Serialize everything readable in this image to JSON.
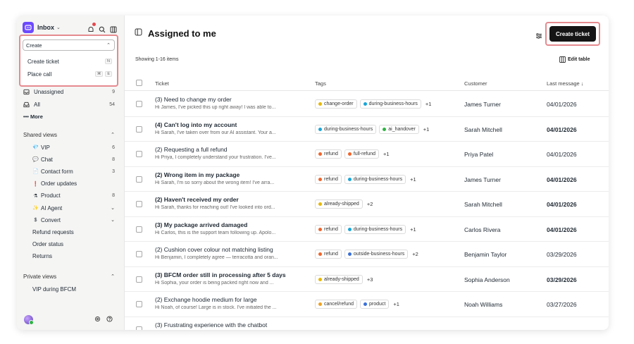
{
  "sidebar": {
    "inbox_label": "Inbox",
    "create_menu": {
      "select_label": "Create",
      "items": [
        {
          "label": "Create ticket",
          "shortcut": [
            "N"
          ]
        },
        {
          "label": "Place call",
          "shortcut": [
            "⌘",
            "E"
          ]
        }
      ]
    },
    "views": [
      {
        "label": "Unassigned",
        "count": "9",
        "icon": "inbox-icon"
      },
      {
        "label": "All",
        "count": "54",
        "icon": "tray-icon"
      }
    ],
    "more_label": "••• More",
    "shared_views": {
      "title": "Shared views",
      "items": [
        {
          "emoji": "💎",
          "label": "VIP",
          "count": "6"
        },
        {
          "emoji": "💬",
          "label": "Chat",
          "count": "8"
        },
        {
          "emoji": "📄",
          "label": "Contact form",
          "count": "3"
        },
        {
          "emoji": "❗",
          "label": "Order updates",
          "count": ""
        },
        {
          "emoji": "⚗",
          "label": "Product",
          "count": "8"
        },
        {
          "emoji": "✨",
          "label": "AI Agent",
          "count": "",
          "expandable": true
        },
        {
          "emoji": "$",
          "label": "Convert",
          "count": "",
          "expandable": true
        },
        {
          "emoji": "",
          "label": "Refund requests",
          "count": ""
        },
        {
          "emoji": "",
          "label": "Order status",
          "count": ""
        },
        {
          "emoji": "",
          "label": "Returns",
          "count": ""
        }
      ]
    },
    "private_views": {
      "title": "Private views",
      "items": [
        {
          "label": "VIP during BFCM"
        }
      ]
    }
  },
  "main": {
    "title": "Assigned to me",
    "create_button": "Create ticket",
    "showing": "Showing 1-16 items",
    "edit_table": "Edit table",
    "columns": {
      "ticket": "Ticket",
      "tags": "Tags",
      "customer": "Customer",
      "last_message": "Last message ↓"
    }
  },
  "tag_colors": {
    "change-order": "#e8b700",
    "during-business-hours": "#1aa5d6",
    "ai_handover": "#2fb344",
    "refund": "#f0642b",
    "full-refund": "#f0642b",
    "already-shipped": "#e8b700",
    "outside-business-hours": "#3b6fd6",
    "cancel/refund": "#f0a020",
    "product": "#3b6fd6"
  },
  "tickets": [
    {
      "subject": "(3) Need to change my order",
      "preview": "Hi James, I've picked this up right away! I was able to...",
      "tags": [
        "change-order",
        "during-business-hours"
      ],
      "more": "+1",
      "customer": "James Turner",
      "date": "04/01/2026",
      "unread": false
    },
    {
      "subject": "(4) Can't log into my account",
      "preview": "Hi Sarah, I've taken over from our AI assistant. Your a...",
      "tags": [
        "during-business-hours",
        "ai_handover"
      ],
      "more": "+1",
      "customer": "Sarah Mitchell",
      "date": "04/01/2026",
      "unread": true
    },
    {
      "subject": "(2) Requesting a full refund",
      "preview": "Hi Priya, I completely understand your frustration. I've...",
      "tags": [
        "refund",
        "full-refund"
      ],
      "more": "+1",
      "customer": "Priya Patel",
      "date": "04/01/2026",
      "unread": false
    },
    {
      "subject": "(2) Wrong item in my package",
      "preview": "Hi Sarah, I'm so sorry about the wrong item! I've arra...",
      "tags": [
        "refund",
        "during-business-hours"
      ],
      "more": "+1",
      "customer": "James Turner",
      "date": "04/01/2026",
      "unread": true
    },
    {
      "subject": "(2) Haven't received my order",
      "preview": "Hi Sarah, thanks for reaching out! I've looked into ord...",
      "tags": [
        "already-shipped"
      ],
      "more": "+2",
      "customer": "Sarah Mitchell",
      "date": "04/01/2026",
      "unread": true
    },
    {
      "subject": "(3) My package arrived damaged",
      "preview": "Hi Carlos, this is the support team following up. Apolo...",
      "tags": [
        "refund",
        "during-business-hours"
      ],
      "more": "+1",
      "customer": "Carlos Rivera",
      "date": "04/01/2026",
      "unread": true
    },
    {
      "subject": "(2) Cushion cover colour not matching listing",
      "preview": "Hi Benjamin, I completely agree — terracotta and oran...",
      "tags": [
        "refund",
        "outside-business-hours"
      ],
      "more": "+2",
      "customer": "Benjamin Taylor",
      "date": "03/29/2026",
      "unread": false
    },
    {
      "subject": "(3) BFCM order still in processing after 5 days",
      "preview": "Hi Sophia, your order is being packed right now and ...",
      "tags": [
        "already-shipped"
      ],
      "more": "+3",
      "customer": "Sophia Anderson",
      "date": "03/29/2026",
      "unread": true
    },
    {
      "subject": "(2) Exchange hoodie medium for large",
      "preview": "Hi Noah, of course! Large is in stock. I've initiated the ...",
      "tags": [
        "cancel/refund",
        "product"
      ],
      "more": "+1",
      "customer": "Noah Williams",
      "date": "03/27/2026",
      "unread": false
    },
    {
      "subject": "(3) Frustrating experience with the chatbot",
      "preview": "",
      "tags": [],
      "more": "",
      "customer": "",
      "date": "",
      "unread": false
    }
  ]
}
